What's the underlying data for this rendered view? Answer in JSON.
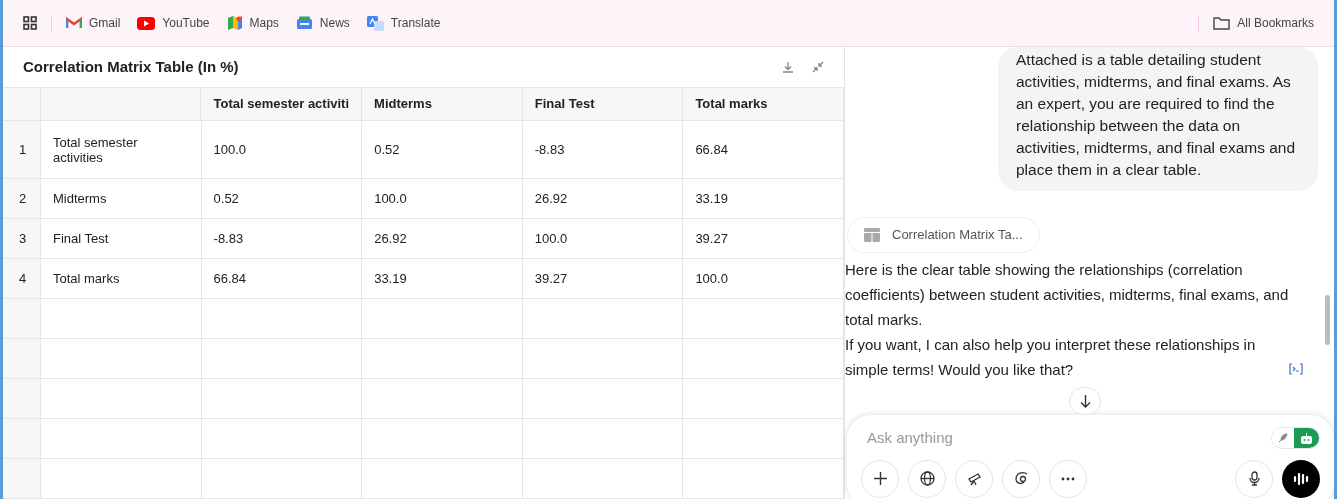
{
  "bookmarks_bar": {
    "items": [
      {
        "label": "Gmail",
        "kind": "gmail"
      },
      {
        "label": "YouTube",
        "kind": "youtube"
      },
      {
        "label": "Maps",
        "kind": "maps"
      },
      {
        "label": "News",
        "kind": "news"
      },
      {
        "label": "Translate",
        "kind": "translate"
      }
    ],
    "all_bookmarks": "All Bookmarks"
  },
  "table_panel": {
    "title": "Correlation Matrix Table (In %)",
    "columns": [
      "Total semester activiti",
      "Midterms",
      "Final Test",
      "Total marks"
    ],
    "rows": [
      {
        "index": "1",
        "name": "Total semester activities",
        "cells": [
          "100.0",
          "0.52",
          "-8.83",
          "66.84"
        ]
      },
      {
        "index": "2",
        "name": "Midterms",
        "cells": [
          "0.52",
          "100.0",
          "26.92",
          "33.19"
        ]
      },
      {
        "index": "3",
        "name": "Final Test",
        "cells": [
          "-8.83",
          "26.92",
          "100.0",
          "39.27"
        ]
      },
      {
        "index": "4",
        "name": "Total marks",
        "cells": [
          "66.84",
          "33.19",
          "39.27",
          "100.0"
        ]
      }
    ]
  },
  "chat": {
    "user_message": "Attached is a table detailing student activities, midterms, and final exams. As an expert, you are required to find the relationship between the data on activities, midterms, and final exams and place them in a clear table.",
    "attachment": "Correlation Matrix Ta...",
    "reply_lines": [
      "Here is the clear table showing the relationships (correlation coefficients) between student activities, midterms, final exams, and total marks.",
      "If you want, I can also help you interpret these relationships in simple terms! Would you like that?"
    ],
    "input": {
      "placeholder": "Ask anything",
      "mode_toggle": [
        {
          "kind": "write",
          "selected": false
        },
        {
          "kind": "agent",
          "selected": true
        }
      ]
    }
  }
}
